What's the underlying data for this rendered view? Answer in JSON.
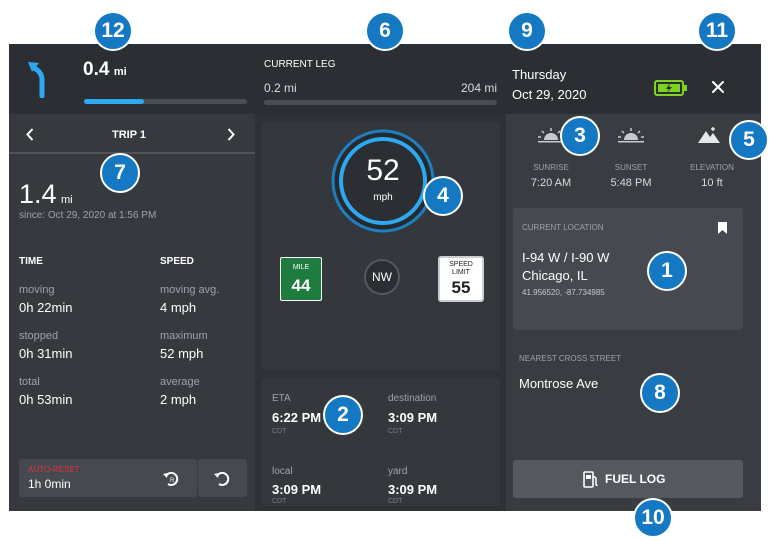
{
  "header": {
    "next_turn_distance": "0.4",
    "next_turn_unit": "mi",
    "next_turn_progress": 0.37,
    "current_leg_label": "CURRENT LEG",
    "leg_done": "0.2 mi",
    "leg_total": "204 mi",
    "day": "Thursday",
    "date": "Oct 29, 2020"
  },
  "trip": {
    "title": "TRIP 1",
    "distance": "1.4",
    "distance_unit": "mi",
    "since": "since: Oct 29, 2020 at 1:56 PM",
    "time_header": "TIME",
    "speed_header": "SPEED",
    "moving_label": "moving",
    "moving_value": "0h 22min",
    "moving_avg_label": "moving avg.",
    "moving_avg_value": "4 mph",
    "stopped_label": "stopped",
    "stopped_value": "0h 31min",
    "maximum_label": "maximum",
    "maximum_value": "52 mph",
    "total_label": "total",
    "total_value": "0h 53min",
    "average_label": "average",
    "average_value": "2 mph",
    "autoreset_label": "AUTO-RESET",
    "autoreset_value": "1h 0min"
  },
  "speed": {
    "value": "52",
    "unit": "mph",
    "mile_label": "MILE",
    "mile_value": "44",
    "heading": "NW",
    "limit_label_1": "SPEED",
    "limit_label_2": "LIMIT",
    "limit_value": "55"
  },
  "times": {
    "eta_label": "ETA",
    "eta_value": "6:22 PM",
    "eta_tz": "CDT",
    "destination_label": "destination",
    "destination_value": "3:09 PM",
    "destination_tz": "CDT",
    "local_label": "local",
    "local_value": "3:09 PM",
    "local_tz": "CDT",
    "yard_label": "yard",
    "yard_value": "3:09 PM",
    "yard_tz": "CDT"
  },
  "sun": {
    "sunrise_label": "SUNRISE",
    "sunrise_value": "7:20 AM",
    "sunset_label": "SUNSET",
    "sunset_value": "5:48 PM",
    "elevation_label": "ELEVATION",
    "elevation_value": "10 ft"
  },
  "location": {
    "label": "CURRENT LOCATION",
    "road": "I-94 W / I-90 W",
    "city": "Chicago, IL",
    "coords": "41.956520, -87.734985"
  },
  "cross_street": {
    "label": "NEAREST CROSS STREET",
    "value": "Montrose Ave"
  },
  "fuel_log_label": "FUEL LOG",
  "callouts": [
    "1",
    "2",
    "3",
    "4",
    "5",
    "6",
    "7",
    "8",
    "9",
    "10",
    "11",
    "12"
  ],
  "colors": {
    "accent_blue": "#2ea8f0",
    "mile_marker_green": "#1e7d3e",
    "auto_reset_red": "#e0353b",
    "callout_blue": "#1478c3",
    "battery_green": "#7ed321"
  },
  "icons": [
    "turn-left-arrow-icon",
    "close-icon",
    "battery-charging-icon",
    "sunrise-icon",
    "sunset-icon",
    "elevation-icon",
    "bookmark-icon",
    "chevron-left-icon",
    "chevron-right-icon",
    "auto-reset-icon",
    "reset-icon",
    "fuel-pump-icon"
  ]
}
